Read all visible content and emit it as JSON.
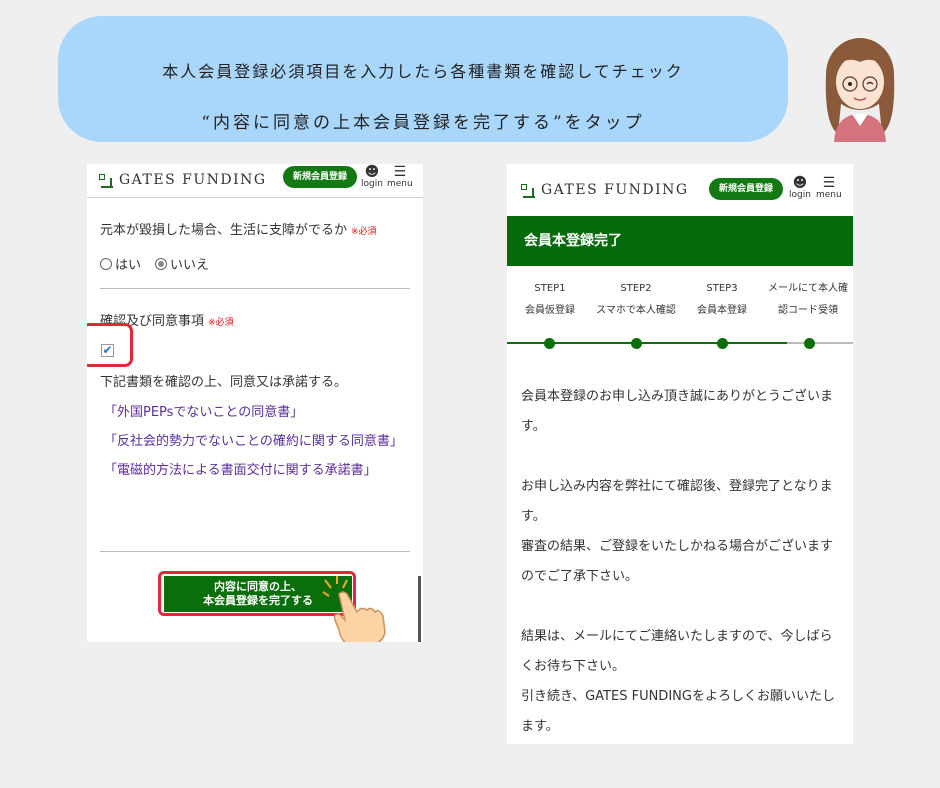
{
  "banner": {
    "line1": "本人会員登録必須項目を入力したら各種書類を確認してチェック",
    "line2": "“内容に同意の上本会員登録を完了する”をタップ"
  },
  "header": {
    "logo": "GATES FUNDING",
    "register_button": "新規会員登録",
    "login_label": "login",
    "menu_label": "menu"
  },
  "form": {
    "question1": "元本が毀損した場合、生活に支障がでるか",
    "required": "※必須",
    "option_yes": "はい",
    "option_no": "いいえ",
    "selected": "いいえ",
    "question2": "確認及び同意事項",
    "agree_text": "下記書類を確認の上、同意又は承諾する。",
    "links": [
      "「外国PEPsでないことの同意書」",
      "「反社会的勢力でないことの確約に関する同意書」",
      "「電磁的方法による書面交付に関する承諾書」"
    ],
    "submit_line1": "内容に同意の上、",
    "submit_line2": "本会員登録を完了する",
    "checked": true
  },
  "complete": {
    "title": "会員本登録完了",
    "steps": [
      {
        "step": "STEP1",
        "label": "会員仮登録"
      },
      {
        "step": "STEP2",
        "label": "スマホで本人確認"
      },
      {
        "step": "STEP3",
        "label": "会員本登録"
      },
      {
        "step": "メールにて本人確",
        "label": "認コード受領"
      }
    ],
    "msg1": "会員本登録のお申し込み頂き誠にありがとうございます。",
    "msg2": "お申し込み内容を弊社にて確認後、登録完了となります。",
    "msg3": "審査の結果、ご登録をいたしかねる場合がございますのでご了承下さい。",
    "msg4": "結果は、メールにてご連絡いたしますので、今しばらくお待ち下さい。",
    "msg5": "引き続き、GATES FUNDINGをよろしくお願いいたします。"
  },
  "colors": {
    "brand_green": "#066b0c",
    "highlight_red": "#e0283a",
    "banner_blue": "#a9d6fb",
    "link_purple": "#5b2e9c"
  },
  "icons": [
    "user-icon",
    "hamburger-menu-icon",
    "check-icon",
    "pointing-hand-icon"
  ]
}
